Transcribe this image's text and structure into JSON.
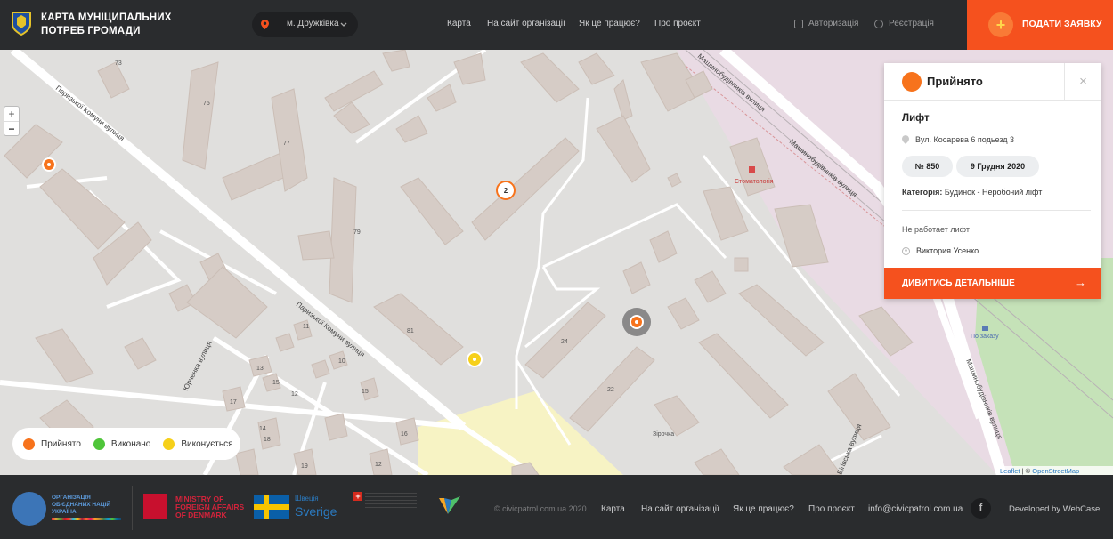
{
  "header": {
    "brand_line1": "КАРТА МУНІЦИПАЛЬНИХ",
    "brand_line2": "ПОТРЕБ ГРОМАДИ",
    "city": "м. Дружківка",
    "nav": [
      "Карта",
      "На сайт організації",
      "Як це працює?",
      "Про проєкт"
    ],
    "login": "Авторизація",
    "register": "Реєстрація",
    "submit": "ПОДАТИ ЗАЯВКУ"
  },
  "map": {
    "street_labels": [
      "Паризької Комуни вулиця",
      "Паризької Комуни вулиця",
      "Юрченка вулиця",
      "Машинобудівників вулиця",
      "Машинобудівників вулиця",
      "Машинобудівників вулиця"
    ],
    "house_numbers": [
      "73",
      "75",
      "77",
      "79",
      "81",
      "24",
      "22",
      "11",
      "13",
      "15",
      "10",
      "17",
      "12",
      "19",
      "14",
      "15",
      "16",
      "18",
      "12"
    ],
    "poi": [
      "Стоматологія",
      "По заказу",
      "Зірочка",
      "Бігівська вулиця"
    ],
    "cluster_count": "2",
    "zoom_in": "+",
    "zoom_out": "−"
  },
  "legend": [
    {
      "label": "Прийнято",
      "color": "#f7731c"
    },
    {
      "label": "Виконано",
      "color": "#4fc53a"
    },
    {
      "label": "Виконується",
      "color": "#f6d01a"
    }
  ],
  "popup": {
    "status": "Прийнято",
    "status_color": "#f7731c",
    "title": "Лифт",
    "address": "Вул. Косарева 6 подьезд 3",
    "number": "№ 850",
    "date": "9 Грудня 2020",
    "category_label": "Категорія:",
    "category_value": "Будинок - Неробочий ліфт",
    "description": "Не работает лифт",
    "author": "Виктория Усенко",
    "more": "ДИВИТИСЬ ДЕТАЛЬНІШЕ",
    "close": "×"
  },
  "attribution": {
    "leaflet": "Leaflet",
    "sep": " | © ",
    "osm": "OpenStreetMap",
    "rest": " contributors"
  },
  "footer": {
    "un_line1": "ОРГАНІЗАЦІЯ",
    "un_line2": "ОБ'ЄДНАНИХ НАЦІЙ",
    "un_line3": "УКРАЇНА",
    "dk_line1": "MINISTRY OF",
    "dk_line2": "FOREIGN AFFAIRS",
    "dk_line3": "OF DENMARK",
    "se_line1": "Швеція",
    "se_line2": "Sverige",
    "copyright": "© civicpatrol.com.ua 2020",
    "links": [
      "Карта",
      "На сайт організації",
      "Як це працює?",
      "Про проєкт",
      "info@civicpatrol.com.ua"
    ],
    "developer": "Developed by WebCase"
  }
}
